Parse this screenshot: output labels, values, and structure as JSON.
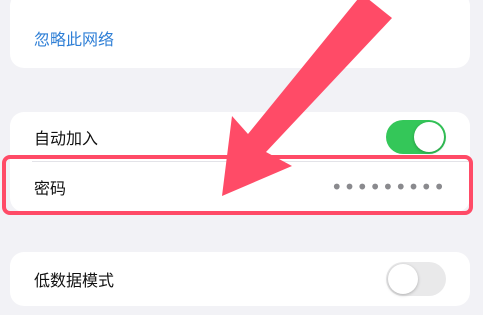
{
  "network_settings": {
    "forget_network_label": "忽略此网络",
    "auto_join": {
      "label": "自动加入",
      "enabled": true
    },
    "password": {
      "label": "密码",
      "masked_value": "•••••••••"
    },
    "low_data_mode": {
      "label": "低数据模式",
      "enabled": false
    }
  },
  "colors": {
    "toggle_on": "#34c759",
    "toggle_off": "#e9e9ea",
    "link": "#2f7fd6",
    "annotation": "#ff4b67",
    "background": "#f2f2f6"
  }
}
